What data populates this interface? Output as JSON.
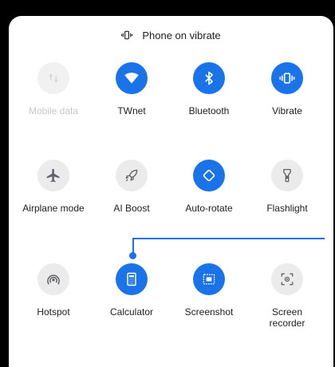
{
  "status": {
    "text": "Phone on vibrate"
  },
  "tiles": [
    {
      "label": "Mobile data",
      "icon": "mobile-data-icon",
      "state": "disabled"
    },
    {
      "label": "TWnet",
      "icon": "wifi-icon",
      "state": "active"
    },
    {
      "label": "Bluetooth",
      "icon": "bluetooth-icon",
      "state": "active"
    },
    {
      "label": "Vibrate",
      "icon": "vibrate-icon",
      "state": "active"
    },
    {
      "label": "Airplane mode",
      "icon": "airplane-icon",
      "state": "inactive"
    },
    {
      "label": "AI Boost",
      "icon": "rocket-icon",
      "state": "inactive"
    },
    {
      "label": "Auto-rotate",
      "icon": "auto-rotate-icon",
      "state": "active"
    },
    {
      "label": "Flashlight",
      "icon": "flashlight-icon",
      "state": "inactive"
    },
    {
      "label": "Hotspot",
      "icon": "hotspot-icon",
      "state": "inactive"
    },
    {
      "label": "Calculator",
      "icon": "calculator-icon",
      "state": "active"
    },
    {
      "label": "Screenshot",
      "icon": "screenshot-icon",
      "state": "active"
    },
    {
      "label": "Screen recorder",
      "icon": "screen-recorder-icon",
      "state": "inactive"
    }
  ],
  "colors": {
    "accent": "#1a73e8",
    "inactive": "#ebebeb",
    "icon_inactive": "#5f6368"
  }
}
